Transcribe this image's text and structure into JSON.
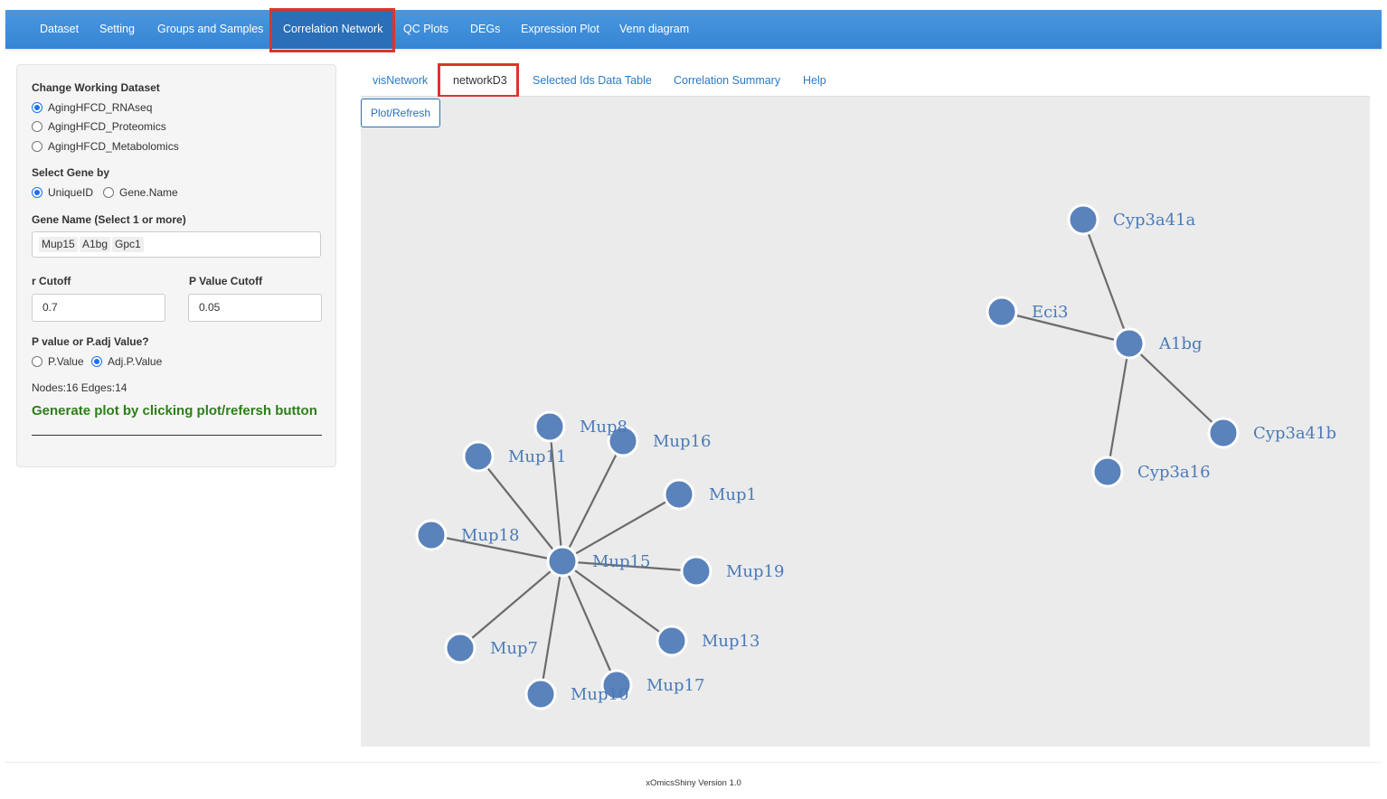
{
  "navbar": {
    "items": [
      {
        "label": "Dataset",
        "active": false
      },
      {
        "label": "Setting",
        "active": false
      },
      {
        "label": "Groups and Samples",
        "active": false
      },
      {
        "label": "Correlation Network",
        "active": true
      },
      {
        "label": "QC Plots",
        "active": false
      },
      {
        "label": "DEGs",
        "active": false
      },
      {
        "label": "Expression Plot",
        "active": false
      },
      {
        "label": "Venn diagram",
        "active": false
      }
    ]
  },
  "sidebar": {
    "dataset_label": "Change Working Dataset",
    "dataset_options": [
      {
        "label": "AgingHFCD_RNAseq",
        "selected": true
      },
      {
        "label": "AgingHFCD_Proteomics",
        "selected": false
      },
      {
        "label": "AgingHFCD_Metabolomics",
        "selected": false
      }
    ],
    "select_gene_by_label": "Select Gene by",
    "select_gene_by_options": [
      {
        "label": "UniqueID",
        "selected": true
      },
      {
        "label": "Gene.Name",
        "selected": false
      }
    ],
    "gene_name_label": "Gene Name (Select 1 or more)",
    "gene_name_selected": [
      "Mup15",
      "A1bg",
      "Gpc1"
    ],
    "r_cutoff_label": "r Cutoff",
    "r_cutoff_value": "0.7",
    "p_cutoff_label": "P Value Cutoff",
    "p_cutoff_value": "0.05",
    "pvalue_type_label": "P value or P.adj Value?",
    "pvalue_type_options": [
      {
        "label": "P.Value",
        "selected": false
      },
      {
        "label": "Adj.P.Value",
        "selected": true
      }
    ],
    "nodes_edges_text": "Nodes:16 Edges:14",
    "generate_text": "Generate plot by clicking plot/refersh button"
  },
  "tabs": [
    {
      "label": "visNetwork",
      "active": false
    },
    {
      "label": "networkD3",
      "active": true
    },
    {
      "label": "Selected Ids Data Table",
      "active": false
    },
    {
      "label": "Correlation Summary",
      "active": false
    },
    {
      "label": "Help",
      "active": false
    }
  ],
  "plot_button_label": "Plot/Refresh",
  "network": {
    "node_color": "#5a82bb",
    "edge_color": "#6b6b6b",
    "nodes": [
      "Cyp3a41a",
      "Eci3",
      "A1bg",
      "Cyp3a41b",
      "Cyp3a16",
      "Mup8",
      "Mup16",
      "Mup11",
      "Mup1",
      "Mup18",
      "Mup15",
      "Mup19",
      "Mup13",
      "Mup7",
      "Mup17",
      "Mup10"
    ],
    "edges": [
      [
        "A1bg",
        "Cyp3a41a"
      ],
      [
        "A1bg",
        "Eci3"
      ],
      [
        "A1bg",
        "Cyp3a41b"
      ],
      [
        "A1bg",
        "Cyp3a16"
      ],
      [
        "Mup15",
        "Mup8"
      ],
      [
        "Mup15",
        "Mup16"
      ],
      [
        "Mup15",
        "Mup11"
      ],
      [
        "Mup15",
        "Mup1"
      ],
      [
        "Mup15",
        "Mup18"
      ],
      [
        "Mup15",
        "Mup19"
      ],
      [
        "Mup15",
        "Mup13"
      ],
      [
        "Mup15",
        "Mup7"
      ],
      [
        "Mup15",
        "Mup17"
      ],
      [
        "Mup15",
        "Mup10"
      ]
    ]
  },
  "footer": "xOmicsShiny Version 1.0"
}
